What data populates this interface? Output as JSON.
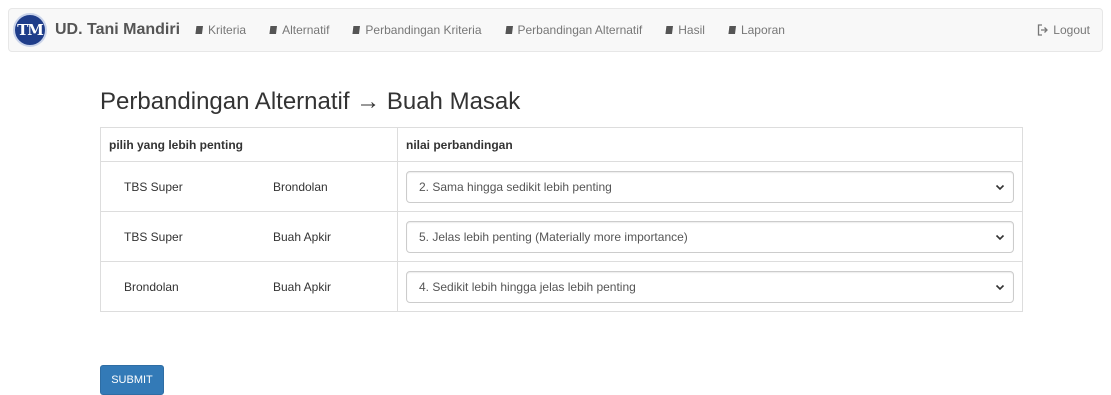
{
  "brand": {
    "logo_text": "TM",
    "name": "UD. Tani Mandiri"
  },
  "nav": {
    "items": [
      {
        "label": "Kriteria",
        "icon": "book-icon"
      },
      {
        "label": "Alternatif",
        "icon": "book-icon"
      },
      {
        "label": "Perbandingan Kriteria",
        "icon": "book-icon"
      },
      {
        "label": "Perbandingan Alternatif",
        "icon": "book-icon"
      },
      {
        "label": "Hasil",
        "icon": "book-icon"
      },
      {
        "label": "Laporan",
        "icon": "book-icon"
      }
    ],
    "logout_label": "Logout"
  },
  "page": {
    "title": "Perbandingan Alternatif → Buah Masak"
  },
  "table": {
    "headers": [
      "pilih yang lebih penting",
      "nilai perbandingan"
    ],
    "rows": [
      {
        "a": "TBS Super",
        "b": "Brondolan",
        "value": "2. Sama hingga sedikit lebih penting"
      },
      {
        "a": "TBS Super",
        "b": "Buah Apkir",
        "value": "5. Jelas lebih penting (Materially more importance)"
      },
      {
        "a": "Brondolan",
        "b": "Buah Apkir",
        "value": "4. Sedikit lebih hingga jelas lebih penting"
      }
    ]
  },
  "submit_label": "SUBMIT",
  "colors": {
    "primary": "#337ab7",
    "navbar_bg": "#f8f8f8",
    "logo": "#1f3d8a"
  }
}
